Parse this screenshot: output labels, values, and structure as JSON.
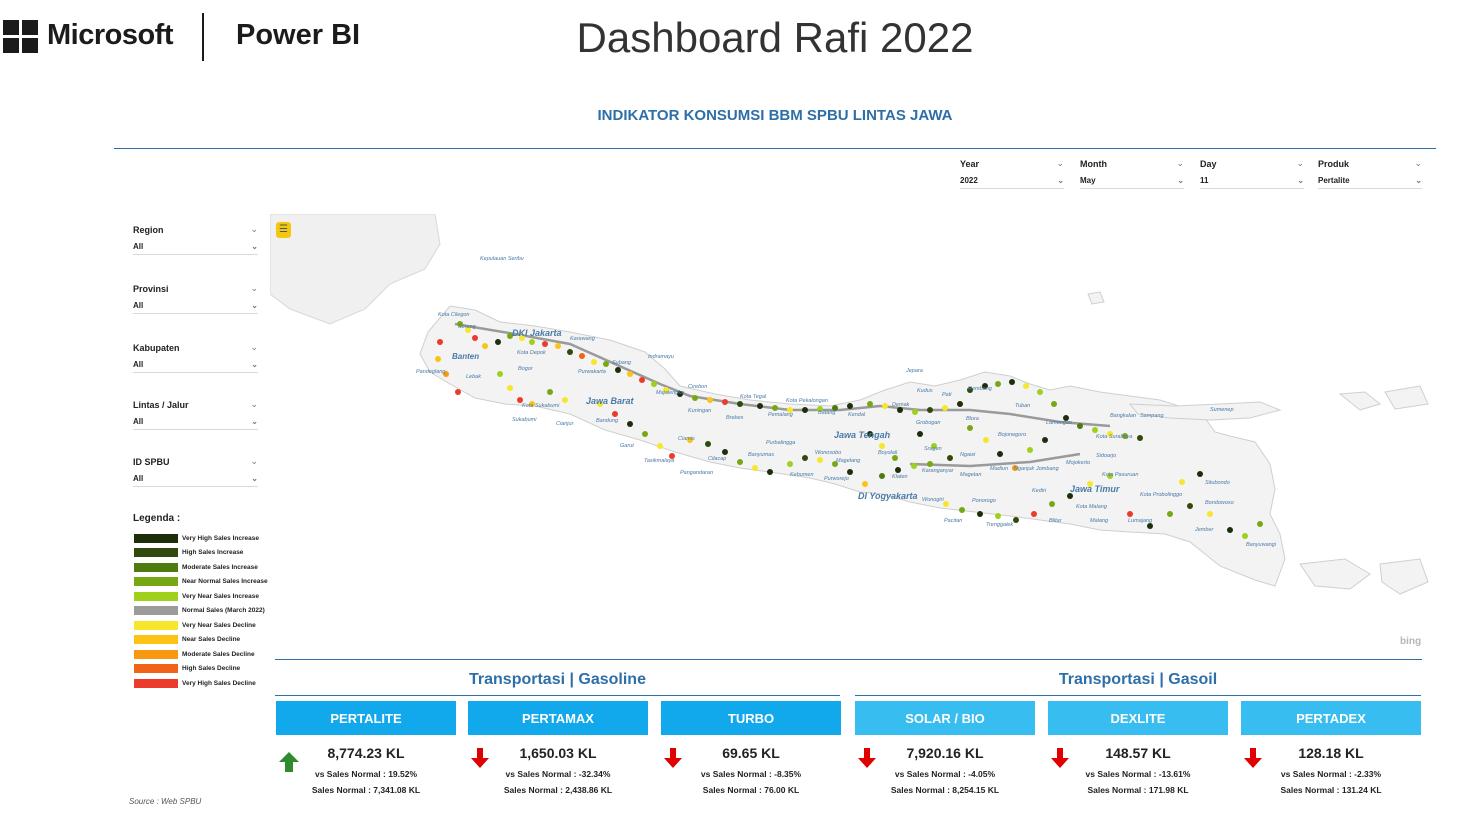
{
  "header": {
    "brand": "Microsoft",
    "product": "Power BI",
    "title": "Dashboard Rafi 2022"
  },
  "report": {
    "title": "INDIKATOR KONSUMSI BBM SPBU LINTAS JAWA",
    "source": "Source :  Web SPBU"
  },
  "top_slicers": [
    {
      "label": "Year",
      "value": "2022"
    },
    {
      "label": "Month",
      "value": "May"
    },
    {
      "label": "Day",
      "value": "11"
    },
    {
      "label": "Produk",
      "value": "Pertalite"
    }
  ],
  "side_slicers": [
    {
      "label": "Region",
      "value": "All"
    },
    {
      "label": "Provinsi",
      "value": "All"
    },
    {
      "label": "Kabupaten",
      "value": "All"
    },
    {
      "label": "Lintas / Jalur",
      "value": "All"
    },
    {
      "label": "ID SPBU",
      "value": "All"
    }
  ],
  "legend": {
    "title": "Legenda :",
    "items": [
      {
        "label": "Very High Sales Increase",
        "color": "#1c2e0a"
      },
      {
        "label": "High Sales Increase",
        "color": "#2f4a0c"
      },
      {
        "label": "Moderate Sales Increase",
        "color": "#4f7a0f"
      },
      {
        "label": "Near Normal Sales Increase",
        "color": "#77a814"
      },
      {
        "label": "Very Near Sales Increase",
        "color": "#9fd11c"
      },
      {
        "label": "Normal Sales (March 2022)",
        "color": "#9b9b9b"
      },
      {
        "label": "Very Near Sales Decline",
        "color": "#f7e62b"
      },
      {
        "label": "Near Sales Decline",
        "color": "#fbc315"
      },
      {
        "label": "Moderate Sales Decline",
        "color": "#f79a12"
      },
      {
        "label": "High Sales Decline",
        "color": "#f2631a"
      },
      {
        "label": "Very High Sales Decline",
        "color": "#ea3b2c"
      }
    ]
  },
  "map": {
    "attribution": "bing",
    "labels": [
      {
        "text": "Kepulauan Seribu",
        "bold": false
      },
      {
        "text": "Kota Cilegon",
        "bold": false
      },
      {
        "text": "Serang",
        "bold": false
      },
      {
        "text": "DKI Jakarta",
        "bold": true
      },
      {
        "text": "Kota Depok",
        "bold": false
      },
      {
        "text": "Banten",
        "bold": true
      },
      {
        "text": "Pandeglang",
        "bold": false
      },
      {
        "text": "Lebak",
        "bold": false
      },
      {
        "text": "Bogor",
        "bold": false
      },
      {
        "text": "Karawang",
        "bold": false
      },
      {
        "text": "Subang",
        "bold": false
      },
      {
        "text": "Indramayu",
        "bold": false
      },
      {
        "text": "Purwakarta",
        "bold": false
      },
      {
        "text": "Kota Sukabumi",
        "bold": false
      },
      {
        "text": "Sukabumi",
        "bold": false
      },
      {
        "text": "Jawa Barat",
        "bold": true
      },
      {
        "text": "Bandung",
        "bold": false
      },
      {
        "text": "Cianjur",
        "bold": false
      },
      {
        "text": "Cirebon",
        "bold": false
      },
      {
        "text": "Majalengka",
        "bold": false
      },
      {
        "text": "Kuningan",
        "bold": false
      },
      {
        "text": "Garut",
        "bold": false
      },
      {
        "text": "Ciamis",
        "bold": false
      },
      {
        "text": "Tasikmalaya",
        "bold": false
      },
      {
        "text": "Pangandaran",
        "bold": false
      },
      {
        "text": "Kota Tegal",
        "bold": false
      },
      {
        "text": "Brebes",
        "bold": false
      },
      {
        "text": "Kota Pekalongan",
        "bold": false
      },
      {
        "text": "Pemalang",
        "bold": false
      },
      {
        "text": "Batang",
        "bold": false
      },
      {
        "text": "Kendal",
        "bold": false
      },
      {
        "text": "Purbalingga",
        "bold": false
      },
      {
        "text": "Jawa Tengah",
        "bold": true
      },
      {
        "text": "Wonosobo",
        "bold": false
      },
      {
        "text": "Cilacap",
        "bold": false
      },
      {
        "text": "Banyumas",
        "bold": false
      },
      {
        "text": "Kebumen",
        "bold": false
      },
      {
        "text": "Purworejo",
        "bold": false
      },
      {
        "text": "Magelang",
        "bold": false
      },
      {
        "text": "Boyolali",
        "bold": false
      },
      {
        "text": "DI Yogyakarta",
        "bold": true
      },
      {
        "text": "Klaten",
        "bold": false
      },
      {
        "text": "Demak",
        "bold": false
      },
      {
        "text": "Jepara",
        "bold": false
      },
      {
        "text": "Kudus",
        "bold": false
      },
      {
        "text": "Pati",
        "bold": false
      },
      {
        "text": "Rembang",
        "bold": false
      },
      {
        "text": "Grobogan",
        "bold": false
      },
      {
        "text": "Blora",
        "bold": false
      },
      {
        "text": "Sragen",
        "bold": false
      },
      {
        "text": "Karanganyar",
        "bold": false
      },
      {
        "text": "Wonogiri",
        "bold": false
      },
      {
        "text": "Pacitan",
        "bold": false
      },
      {
        "text": "Ponorogo",
        "bold": false
      },
      {
        "text": "Magetan",
        "bold": false
      },
      {
        "text": "Ngawi",
        "bold": false
      },
      {
        "text": "Madiun",
        "bold": false
      },
      {
        "text": "Bojonegoro",
        "bold": false
      },
      {
        "text": "Tuban",
        "bold": false
      },
      {
        "text": "Lamongan",
        "bold": false
      },
      {
        "text": "Kota Surabaya",
        "bold": false
      },
      {
        "text": "Nganjuk",
        "bold": false
      },
      {
        "text": "Kediri",
        "bold": false
      },
      {
        "text": "Jombang",
        "bold": false
      },
      {
        "text": "Mojokerto",
        "bold": false
      },
      {
        "text": "Trenggalek",
        "bold": false
      },
      {
        "text": "Blitar",
        "bold": false
      },
      {
        "text": "Jawa Timur",
        "bold": true
      },
      {
        "text": "Kota Malang",
        "bold": false
      },
      {
        "text": "Malang",
        "bold": false
      },
      {
        "text": "Lumajang",
        "bold": false
      },
      {
        "text": "Kota Pasuruan",
        "bold": false
      },
      {
        "text": "Kota Probolinggo",
        "bold": false
      },
      {
        "text": "Bondowoso",
        "bold": false
      },
      {
        "text": "Situbondo",
        "bold": false
      },
      {
        "text": "Jember",
        "bold": false
      },
      {
        "text": "Banyuwangi",
        "bold": false
      },
      {
        "text": "Bangkalan",
        "bold": false
      },
      {
        "text": "Sampang",
        "bold": false
      },
      {
        "text": "Sumenep",
        "bold": false
      },
      {
        "text": "Sidoarjo",
        "bold": false
      }
    ]
  },
  "groups": [
    {
      "title": "Transportasi | Gasoline",
      "header_color": "#12a9ec",
      "cards": [
        {
          "name": "PERTALITE",
          "value": "8,774.23 KL",
          "vs": "vs Sales Normal : 19.52%",
          "normal": "Sales Normal : 7,341.08 KL",
          "trend": "up"
        },
        {
          "name": "PERTAMAX",
          "value": "1,650.03 KL",
          "vs": "vs Sales Normal : -32.34%",
          "normal": "Sales Normal : 2,438.86 KL",
          "trend": "down"
        },
        {
          "name": "TURBO",
          "value": "69.65 KL",
          "vs": "vs Sales Normal : -8.35%",
          "normal": "Sales Normal : 76.00 KL",
          "trend": "down"
        }
      ]
    },
    {
      "title": "Transportasi | Gasoil",
      "header_color": "#38bdf0",
      "cards": [
        {
          "name": "SOLAR / BIO",
          "value": "7,920.16 KL",
          "vs": "vs Sales Normal : -4.05%",
          "normal": "Sales Normal : 8,254.15 KL",
          "trend": "down"
        },
        {
          "name": "DEXLITE",
          "value": "148.57 KL",
          "vs": "vs Sales Normal : -13.61%",
          "normal": "Sales Normal : 171.98 KL",
          "trend": "down"
        },
        {
          "name": "PERTADEX",
          "value": "128.18 KL",
          "vs": "vs Sales Normal : -2.33%",
          "normal": "Sales Normal : 131.24 KL",
          "trend": "down"
        }
      ]
    }
  ],
  "colors": {
    "accent": "#2e6fa8",
    "up_arrow": "#2e8b2e",
    "down_arrow": "#e00000"
  }
}
